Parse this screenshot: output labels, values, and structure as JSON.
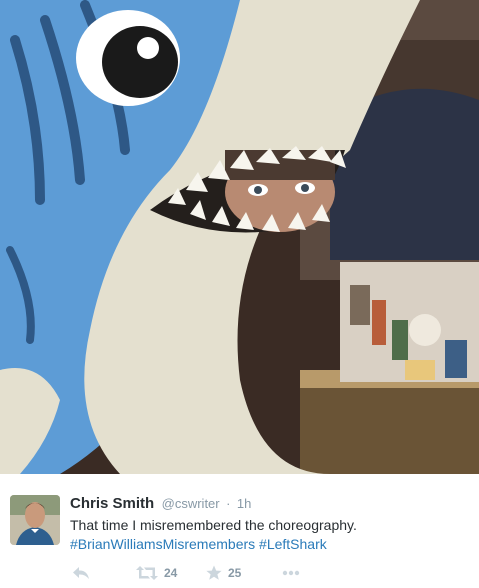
{
  "tweet": {
    "author_name": "Chris Smith",
    "handle": "@cswriter",
    "separator": "·",
    "time": "1h",
    "text": "That time I misremembered the choreography.",
    "hashtags": [
      "#BrianWilliamsMisremembers",
      "#LeftShark"
    ],
    "retweet_count": "24",
    "favorite_count": "25"
  },
  "icons": {
    "reply": "reply-arrow-icon",
    "retweet": "retweet-icon",
    "favorite": "star-icon",
    "more": "more-dots-icon"
  },
  "colors": {
    "name_text": "#292f33",
    "meta_text": "#8899a6",
    "hashtag": "#2b7bb9",
    "icon": "#ccd6dd",
    "shark_blue": "#5d9cd6",
    "shark_belly": "#e4e0cf"
  }
}
